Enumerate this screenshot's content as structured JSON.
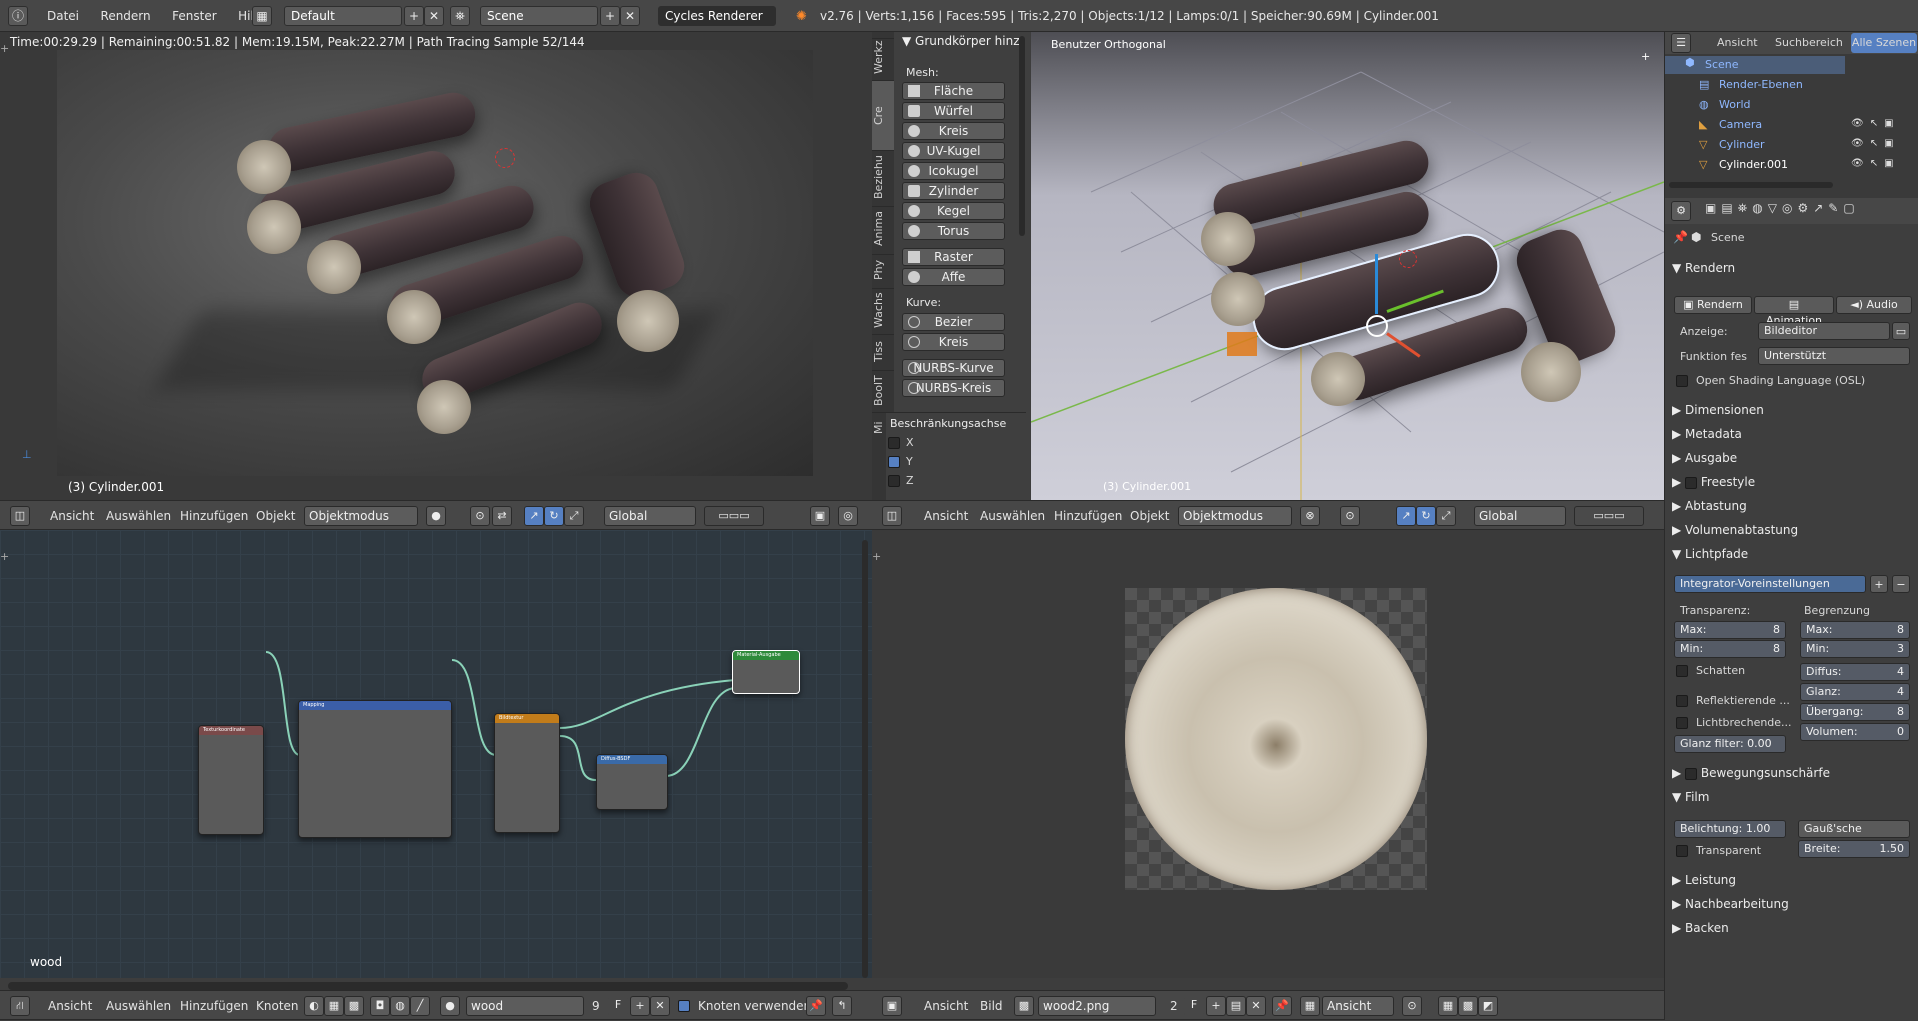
{
  "topbar": {
    "menus": [
      "Datei",
      "Rendern",
      "Fenster",
      "Hilfe"
    ],
    "layout": "Default",
    "scene": "Scene",
    "engine": "Cycles Renderer",
    "stats": "v2.76 | Verts:1,156 | Faces:595 | Tris:2,270 | Objects:1/12 | Lamps:0/1 | Speicher:90.69M | Cylinder.001"
  },
  "render_view": {
    "status": "Time:00:29.29 | Remaining:00:51.82 | Mem:19.15M, Peak:22.27M | Path Tracing Sample 52/144",
    "object_label": "(3) Cylinder.001"
  },
  "tools": {
    "tabs": [
      "Werkz",
      "Cre",
      "Beziehu",
      "Anima",
      "Phy",
      "Wachs",
      "Tiss",
      "BoolT",
      "Mi"
    ],
    "panel_title": "Grundkörper hinz",
    "mesh_label": "Mesh:",
    "mesh_items": [
      "Fläche",
      "Würfel",
      "Kreis",
      "UV-Kugel",
      "Icokugel",
      "Zylinder",
      "Kegel",
      "Torus"
    ],
    "extra_items": [
      "Raster",
      "Affe"
    ],
    "curve_label": "Kurve:",
    "curve_items": [
      "Bezier",
      "Kreis",
      "NURBS-Kurve",
      "NURBS-Kreis"
    ],
    "constraint_title": "Beschränkungsachse",
    "axes": [
      {
        "label": "X",
        "checked": false
      },
      {
        "label": "Y",
        "checked": true
      },
      {
        "label": "Z",
        "checked": false
      }
    ]
  },
  "viewport": {
    "title": "Benutzer Orthogonal",
    "object_label": "(3) Cylinder.001"
  },
  "view3d_header_left": {
    "menus": [
      "Ansicht",
      "Auswählen",
      "Hinzufügen",
      "Objekt"
    ],
    "mode": "Objektmodus",
    "orientation": "Global"
  },
  "view3d_header_right": {
    "menus": [
      "Ansicht",
      "Auswählen",
      "Hinzufügen",
      "Objekt"
    ],
    "mode": "Objektmodus",
    "orientation": "Global"
  },
  "outliner": {
    "tabs": [
      "Ansicht",
      "Suchbereich",
      "Alle Szenen"
    ],
    "items": [
      "Scene",
      "Render-Ebenen",
      "World",
      "Camera",
      "Cylinder",
      "Cylinder.001"
    ]
  },
  "properties": {
    "scene_name": "Scene",
    "render_section": "Rendern",
    "render_buttons": [
      "Rendern",
      "Animation",
      "Audio"
    ],
    "anzeige_label": "Anzeige:",
    "anzeige_value": "Bildeditor",
    "funktion_label": "Funktion fes",
    "funktion_value": "Unterstützt",
    "osl_label": "Open Shading Language (OSL)",
    "sections": [
      "Dimensionen",
      "Metadata",
      "Ausgabe",
      "Freestyle",
      "Abtastung",
      "Volumenabtastung"
    ],
    "lichtpfade": "Lichtpfade",
    "preset": "Integrator-Voreinstellungen",
    "transparenz_label": "Transparenz:",
    "begrenzung_label": "Begrenzung",
    "t_max": "Max:",
    "t_max_val": "8",
    "t_min": "Min:",
    "t_min_val": "8",
    "b_max": "Max:",
    "b_max_val": "8",
    "b_min": "Min:",
    "b_min_val": "3",
    "schatten": "Schatten",
    "diffus": "Diffus:",
    "diffus_val": "4",
    "glanz": "Glanz:",
    "glanz_val": "4",
    "reflekt": "Reflektierende ...",
    "uebergang": "Übergang:",
    "uebergang_val": "8",
    "lichtbr": "Lichtbrechende...",
    "volumen": "Volumen:",
    "volumen_val": "0",
    "glanzfilter": "Glanz filter: 0.00",
    "bewegung": "Bewegungsunschärfe",
    "film": "Film",
    "belichtung": "Belichtung: 1.00",
    "gauss": "Gauß'sche",
    "transparent": "Transparent",
    "breite": "Breite:",
    "breite_val": "1.50",
    "bottom_sections": [
      "Leistung",
      "Nachbearbeitung",
      "Backen"
    ]
  },
  "node_editor": {
    "material_label": "wood",
    "footer_menus": [
      "Ansicht",
      "Auswählen",
      "Hinzufügen",
      "Knoten"
    ],
    "material_field": "wood",
    "users": "9",
    "f_label": "F",
    "use_nodes": "Knoten verwenden",
    "nodes": {
      "texcoord": "Texturkoordinate",
      "mapping": "Mapping",
      "image": "Bildtextur",
      "diffuse": "Diffus-BSDF",
      "output": "Material-Ausgabe"
    }
  },
  "image_editor": {
    "footer_menus": [
      "Ansicht",
      "Bild"
    ],
    "image_name": "wood2.png",
    "users": "2",
    "f_label": "F",
    "view_mode": "Ansicht"
  }
}
